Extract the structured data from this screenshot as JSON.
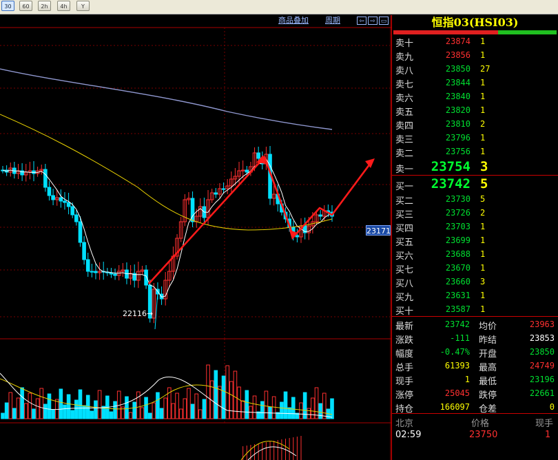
{
  "toolbar": {
    "buttons": [
      "30",
      "60",
      "2h",
      "4h",
      "Y"
    ]
  },
  "chart": {
    "overlay_label": "商品叠加",
    "period_label": "周期",
    "nav_left": "⇦",
    "nav_right": "⇨",
    "nav_expand": "▭",
    "price_tag": "23171",
    "low_label": "22116→"
  },
  "panel": {
    "title": "恒指03(HSI03)",
    "asks": [
      {
        "label": "卖十",
        "price": "23874",
        "vol": "1",
        "color": "#ff3030"
      },
      {
        "label": "卖九",
        "price": "23856",
        "vol": "1",
        "color": "#ff3030"
      },
      {
        "label": "卖八",
        "price": "23850",
        "vol": "27",
        "color": "#00e030"
      },
      {
        "label": "卖七",
        "price": "23844",
        "vol": "1",
        "color": "#00e030"
      },
      {
        "label": "卖六",
        "price": "23840",
        "vol": "1",
        "color": "#00e030"
      },
      {
        "label": "卖五",
        "price": "23820",
        "vol": "1",
        "color": "#00e030"
      },
      {
        "label": "卖四",
        "price": "23810",
        "vol": "2",
        "color": "#00e030"
      },
      {
        "label": "卖三",
        "price": "23796",
        "vol": "1",
        "color": "#00e030"
      },
      {
        "label": "卖二",
        "price": "23756",
        "vol": "1",
        "color": "#00e030"
      }
    ],
    "ask1": {
      "label": "卖一",
      "price": "23754",
      "vol": "3"
    },
    "bid1": {
      "label": "买一",
      "price": "23742",
      "vol": "5"
    },
    "bids": [
      {
        "label": "买二",
        "price": "23730",
        "vol": "5"
      },
      {
        "label": "买三",
        "price": "23726",
        "vol": "2"
      },
      {
        "label": "买四",
        "price": "23703",
        "vol": "1"
      },
      {
        "label": "买五",
        "price": "23699",
        "vol": "1"
      },
      {
        "label": "买六",
        "price": "23688",
        "vol": "1"
      },
      {
        "label": "买七",
        "price": "23670",
        "vol": "1"
      },
      {
        "label": "买八",
        "price": "23660",
        "vol": "3"
      },
      {
        "label": "买九",
        "price": "23631",
        "vol": "1"
      },
      {
        "label": "买十",
        "price": "23587",
        "vol": "1"
      }
    ],
    "stats": [
      {
        "l1": "最新",
        "v1": "23742",
        "c1": "#00e030",
        "l2": "均价",
        "v2": "23963",
        "c2": "#ff3030"
      },
      {
        "l1": "涨跌",
        "v1": "-111",
        "c1": "#00e030",
        "l2": "昨结",
        "v2": "23853",
        "c2": "#ffffff"
      },
      {
        "l1": "幅度",
        "v1": "-0.47%",
        "c1": "#00e030",
        "l2": "开盘",
        "v2": "23850",
        "c2": "#00e030"
      },
      {
        "l1": "总手",
        "v1": "61393",
        "c1": "#ffff00",
        "l2": "最高",
        "v2": "24749",
        "c2": "#ff3030"
      },
      {
        "l1": "现手",
        "v1": "1",
        "c1": "#ffff00",
        "l2": "最低",
        "v2": "23196",
        "c2": "#00e030"
      },
      {
        "l1": "涨停",
        "v1": "25045",
        "c1": "#ff3030",
        "l2": "跌停",
        "v2": "22661",
        "c2": "#00e030"
      },
      {
        "l1": "持仓",
        "v1": "166097",
        "c1": "#ffff00",
        "l2": "仓差",
        "v2": "0",
        "c2": "#ffff00"
      }
    ],
    "ticks_header": {
      "place": "北京",
      "price": "价格",
      "vol": "现手"
    },
    "ticks": [
      {
        "time": "02:59",
        "price": "23750",
        "vol": "1"
      }
    ]
  },
  "colors": {
    "up": "#ff3030",
    "down": "#00e0ff",
    "ma_yellow": "#e8d000",
    "ma_white": "#ffffff",
    "ma_long": "#9098d0",
    "arrow": "#ff1a1a"
  }
}
